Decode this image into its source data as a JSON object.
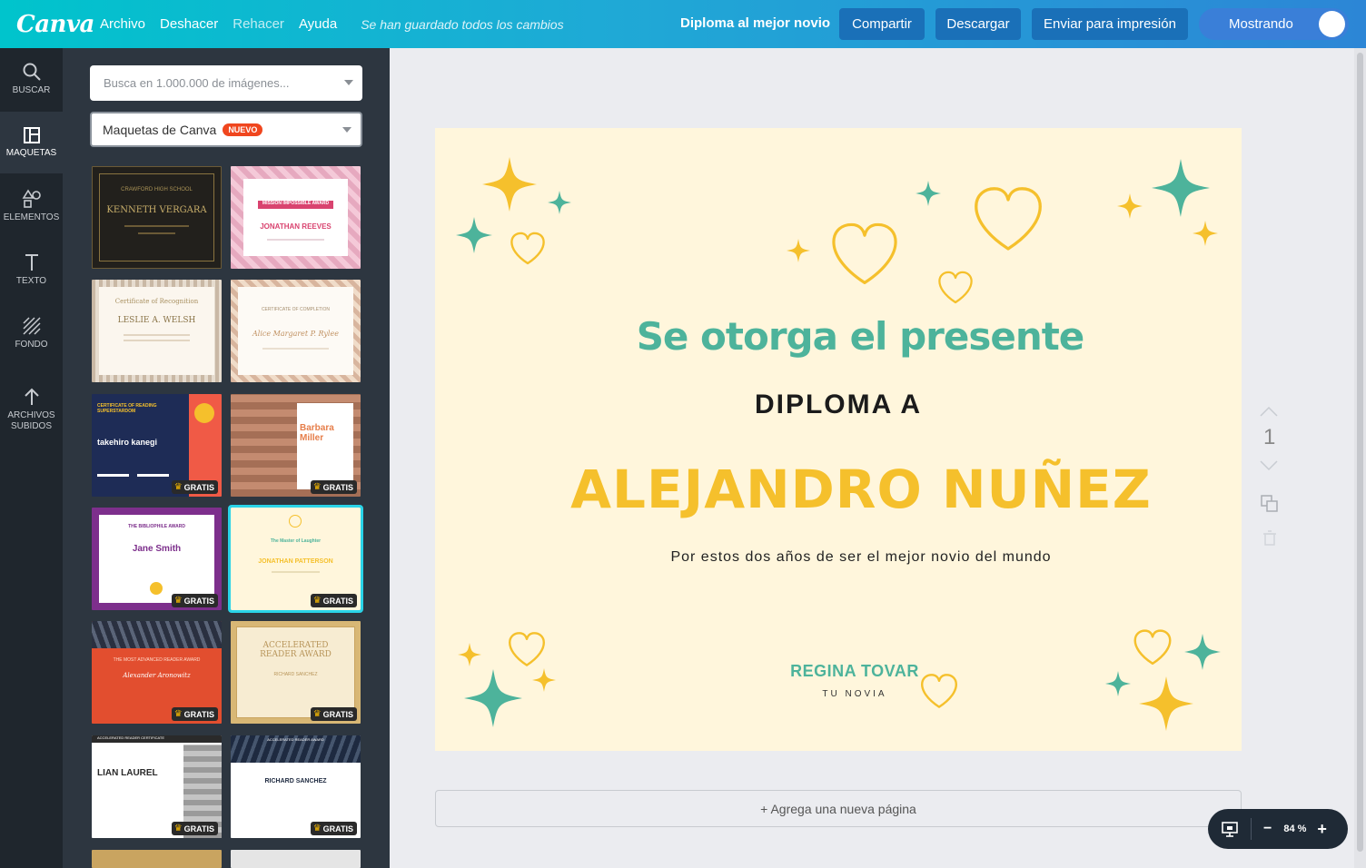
{
  "topbar": {
    "logo": "Canva",
    "menu": [
      "Archivo",
      "Deshacer",
      "Rehacer",
      "Ayuda"
    ],
    "saved_status": "Se han guardado todos los cambios",
    "design_title": "Diploma al mejor novio",
    "share_label": "Compartir",
    "download_label": "Descargar",
    "print_label": "Enviar para impresión",
    "toggle_label": "Mostrando"
  },
  "rail": {
    "items": [
      "BUSCAR",
      "MAQUETAS",
      "ELEMENTOS",
      "TEXTO",
      "FONDO",
      "ARCHIVOS SUBIDOS"
    ]
  },
  "panel": {
    "search_placeholder": "Busca en 1.000.000 de imágenes...",
    "select_label": "Maquetas de Canva",
    "new_badge": "NUEVO",
    "free_label": "GRATIS",
    "thumbs": [
      {
        "main": "KENNETH VERGARA",
        "top": "CRAWFORD HIGH SCHOOL"
      },
      {
        "main": "JONATHAN REEVES",
        "top": "MISSION IMPOSSIBLE AWARD"
      },
      {
        "main": "LESLIE A. WELSH",
        "top": "Certificate of Recognition"
      },
      {
        "main": "Alice Margaret P. Rylee",
        "top": "CERTIFICATE OF COMPLETION"
      },
      {
        "main": "takehiro kanegi",
        "top": "CERTIFICATE OF READING SUPERSTARDOM"
      },
      {
        "main": "Barbara Miller",
        "top": ""
      },
      {
        "main": "Jane Smith",
        "top": "THE BIBLIOPHILE AWARD"
      },
      {
        "main": "JONATHAN PATTERSON",
        "top": "The Master of Laughter"
      },
      {
        "main": "Alexander Aronowitz",
        "top": "THE MOST ADVANCED READER AWARD"
      },
      {
        "main": "ACCELERATED READER AWARD",
        "top": "RICHARD SANCHEZ"
      },
      {
        "main": "LIAN LAUREL",
        "top": "ACCELERATED READER CERTIFICATE"
      },
      {
        "main": "RICHARD SANCHEZ",
        "top": "ACCELERATED READER AWARD"
      }
    ]
  },
  "diploma": {
    "line1": "Se otorga el presente",
    "line2": "DIPLOMA A",
    "name": "ALEJANDRO NUÑEZ",
    "reason": "Por estos dos años de ser el mejor novio del mundo",
    "signer": "REGINA TOVAR",
    "signer_role": "TU NOVIA",
    "colors": {
      "teal": "#4db39b",
      "gold": "#f5c02c",
      "bg": "#fff6dc"
    }
  },
  "page_nav": {
    "page": "1"
  },
  "add_page_label": "+ Agrega una nueva página",
  "zoom": {
    "value": "84 %",
    "minus": "−",
    "plus": "+"
  }
}
